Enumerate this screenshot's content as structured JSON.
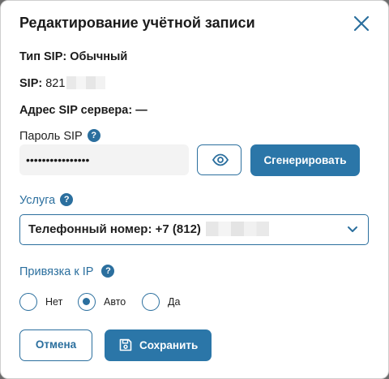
{
  "dialog": {
    "title": "Редактирование учётной записи",
    "close_icon": "close-icon"
  },
  "sip_type": {
    "label": "Тип SIP:",
    "value": "Обычный"
  },
  "sip": {
    "label": "SIP:",
    "value": "821"
  },
  "sip_server": {
    "label": "Адрес SIP сервера:",
    "value": "—"
  },
  "password": {
    "label": "Пароль SIP",
    "value": "••••••••••••••••",
    "show_icon": "eye-icon",
    "generate_label": "Сгенерировать"
  },
  "service": {
    "label": "Услуга",
    "selected": "Телефонный номер: +7 (812)"
  },
  "ip_binding": {
    "label": "Привязка к IP",
    "options": [
      {
        "label": "Нет",
        "selected": false
      },
      {
        "label": "Авто",
        "selected": true
      },
      {
        "label": "Да",
        "selected": false
      }
    ]
  },
  "actions": {
    "cancel_label": "Отмена",
    "save_label": "Сохранить",
    "save_icon": "floppy-disk-icon"
  },
  "colors": {
    "accent": "#2b76a8",
    "border_accent": "#2b6f9e",
    "input_bg": "#f3f3f3"
  }
}
